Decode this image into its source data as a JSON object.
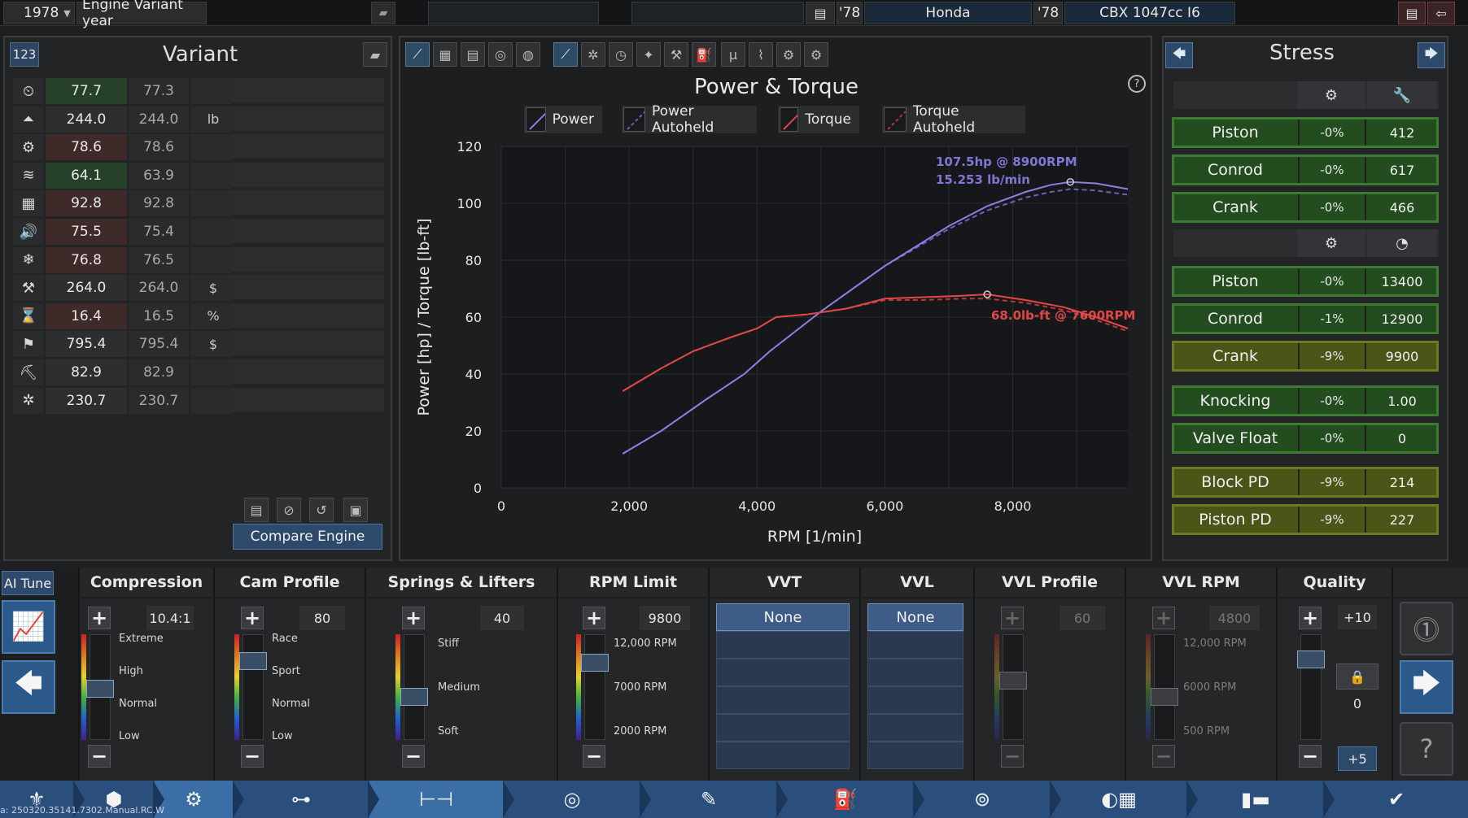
{
  "topbar": {
    "year": "1978",
    "year_arrow": "▼",
    "variant_label": "Engine Variant year",
    "car_icon": "car-icon",
    "family_year": "'78",
    "family_name": "Honda",
    "variant_year": "'78",
    "variant_name": "CBX 1047cc I6"
  },
  "variant": {
    "badge": "123",
    "title": "Variant",
    "rows": [
      {
        "icon": "⏲",
        "icon_name": "performance-index-icon",
        "current": "77.7",
        "compare": "77.3",
        "unit": "",
        "color": "#26402a"
      },
      {
        "icon": "⏶",
        "icon_name": "weight-icon",
        "current": "244.0",
        "compare": "244.0",
        "unit": "lb",
        "color": "#2f2e2e"
      },
      {
        "icon": "⚙",
        "icon_name": "smoothness-icon",
        "current": "78.6",
        "compare": "78.6",
        "unit": "",
        "color": "#3f2a2a"
      },
      {
        "icon": "≋",
        "icon_name": "responsiveness-icon",
        "current": "64.1",
        "compare": "63.9",
        "unit": "",
        "color": "#26402a"
      },
      {
        "icon": "▦",
        "icon_name": "fuel-economy-icon",
        "current": "92.8",
        "compare": "92.8",
        "unit": "",
        "color": "#3f2a2a"
      },
      {
        "icon": "🔊",
        "icon_name": "noise-icon",
        "current": "75.5",
        "compare": "75.4",
        "unit": "",
        "color": "#3f2a2a"
      },
      {
        "icon": "❄",
        "icon_name": "emissions-icon",
        "current": "76.8",
        "compare": "76.5",
        "unit": "",
        "color": "#3f2a2a"
      },
      {
        "icon": "⚒",
        "icon_name": "material-cost-icon",
        "current": "264.0",
        "compare": "264.0",
        "unit": "$",
        "color": "#2f2e2e"
      },
      {
        "icon": "⌛",
        "icon_name": "production-units-icon",
        "current": "16.4",
        "compare": "16.5",
        "unit": "%",
        "color": "#3f2a2a"
      },
      {
        "icon": "⚑",
        "icon_name": "total-cost-icon",
        "current": "795.4",
        "compare": "795.4",
        "unit": "$",
        "color": "#2f2e2e"
      },
      {
        "icon": "⛏",
        "icon_name": "service-cost-icon",
        "current": "82.9",
        "compare": "82.9",
        "unit": "",
        "color": "#2f2e2e"
      },
      {
        "icon": "✲",
        "icon_name": "reliability-icon",
        "current": "230.7",
        "compare": "230.7",
        "unit": "",
        "color": "#2f2e2e"
      }
    ],
    "compare_button": "Compare Engine"
  },
  "chart_data": {
    "type": "line",
    "title": "Power & Torque",
    "xlabel": "RPM [1/min]",
    "ylabel": "Power [hp] / Torque [lb-ft]",
    "xlim": [
      0,
      9800
    ],
    "ylim": [
      0,
      120
    ],
    "xticks": [
      0,
      2000,
      4000,
      6000,
      8000
    ],
    "xtick_labels": [
      "0",
      "2,000",
      "4,000",
      "6,000",
      "8,000"
    ],
    "yticks": [
      0,
      20,
      40,
      60,
      80,
      100,
      120
    ],
    "grid": true,
    "legend_placement": "top",
    "series": [
      {
        "name": "Power",
        "color": "#8a7fe0",
        "dash": "",
        "x": [
          1900,
          2500,
          3200,
          3800,
          4200,
          4600,
          5000,
          5500,
          6000,
          6500,
          7000,
          7600,
          8200,
          8600,
          8900,
          9300,
          9800
        ],
        "y": [
          12,
          20,
          31,
          40,
          48,
          55,
          62,
          70,
          78,
          85,
          92,
          99,
          104,
          106.5,
          107.5,
          107,
          105
        ]
      },
      {
        "name": "Power Autoheld",
        "color": "#6a62b8",
        "dash": "6,4",
        "x": [
          1900,
          2500,
          3200,
          3800,
          4200,
          4600,
          5000,
          5500,
          6000,
          6500,
          7000,
          7600,
          8200,
          8600,
          8900,
          9300,
          9800
        ],
        "y": [
          12,
          20,
          31,
          40,
          48,
          55,
          62,
          70,
          78,
          84.5,
          91,
          97.5,
          102,
          104,
          105,
          104.5,
          103
        ]
      },
      {
        "name": "Torque",
        "color": "#e04848",
        "dash": "",
        "x": [
          1900,
          2500,
          3000,
          3600,
          4000,
          4300,
          4800,
          5400,
          6000,
          6600,
          7200,
          7600,
          8200,
          8800,
          9300,
          9800
        ],
        "y": [
          34,
          42,
          48,
          53,
          56,
          60,
          61,
          63,
          66.5,
          67,
          67.5,
          68,
          66,
          63.5,
          60,
          56
        ]
      },
      {
        "name": "Torque Autoheld",
        "color": "#b23a3a",
        "dash": "6,4",
        "x": [
          1900,
          2500,
          3000,
          3600,
          4000,
          4300,
          4800,
          5400,
          6000,
          6600,
          7200,
          7600,
          8200,
          8800,
          9300,
          9800
        ],
        "y": [
          34,
          42,
          48,
          53,
          56,
          60,
          61,
          63,
          66,
          66,
          66.5,
          66.5,
          65,
          62.5,
          59,
          55
        ]
      }
    ],
    "annotations": [
      {
        "text": "107.5hp @ 8900RPM",
        "x": 8900,
        "y": 107.5,
        "color": "#7f76d6"
      },
      {
        "text": "15.253 lb/min",
        "color": "#7f76d6"
      },
      {
        "text": "68.0lb-ft @ 7600RPM",
        "x": 7600,
        "y": 68,
        "color": "#e04848"
      }
    ]
  },
  "stress": {
    "title": "Stress",
    "header1_icons": [
      "piston-icon",
      "wrench-icon"
    ],
    "header2_icons": [
      "rpm-piston-icon",
      "speedometer-icon"
    ],
    "group1": [
      {
        "name": "Piston",
        "pct": "-0%",
        "val": "412",
        "warn": false
      },
      {
        "name": "Conrod",
        "pct": "-0%",
        "val": "617",
        "warn": false
      },
      {
        "name": "Crank",
        "pct": "-0%",
        "val": "466",
        "warn": false
      }
    ],
    "group2": [
      {
        "name": "Piston",
        "pct": "-0%",
        "val": "13400",
        "warn": false
      },
      {
        "name": "Conrod",
        "pct": "-1%",
        "val": "12900",
        "warn": false
      },
      {
        "name": "Crank",
        "pct": "-9%",
        "val": "9900",
        "warn": true
      }
    ],
    "group3": [
      {
        "name": "Knocking",
        "pct": "-0%",
        "val": "1.00",
        "warn": false
      },
      {
        "name": "Valve Float",
        "pct": "-0%",
        "val": "0",
        "warn": false
      }
    ],
    "group4": [
      {
        "name": "Block PD",
        "pct": "-9%",
        "val": "214",
        "warn": true
      },
      {
        "name": "Piston PD",
        "pct": "-9%",
        "val": "227",
        "warn": true
      }
    ]
  },
  "tune": {
    "ai_tune": "AI Tune",
    "compression": {
      "title": "Compression",
      "value": "10.4:1",
      "labels": [
        "Extreme",
        "High",
        "Normal",
        "Low"
      ]
    },
    "cam": {
      "title": "Cam Profile",
      "value": "80",
      "labels": [
        "Race",
        "Sport",
        "Normal",
        "Low"
      ]
    },
    "springs": {
      "title": "Springs & Lifters",
      "value": "40",
      "labels": [
        "Stiff",
        "Medium",
        "Soft"
      ]
    },
    "rpm": {
      "title": "RPM Limit",
      "value": "9800",
      "labels": [
        "12,000 RPM",
        "7000 RPM",
        "2000 RPM"
      ]
    },
    "vvt": {
      "title": "VVT",
      "selected": "None"
    },
    "vvl": {
      "title": "VVL",
      "selected": "None"
    },
    "vvl_profile": {
      "title": "VVL Profile",
      "value": "60"
    },
    "vvl_rpm": {
      "title": "VVL RPM",
      "value": "4800",
      "labels": [
        "12,000 RPM",
        "6000 RPM",
        "500 RPM"
      ]
    },
    "quality": {
      "title": "Quality",
      "value": "+10",
      "lock_value": "0",
      "minus_value": "+5"
    }
  },
  "statusbar": {
    "version": "a: 250320.35141.7302.Manual.RC.W"
  }
}
